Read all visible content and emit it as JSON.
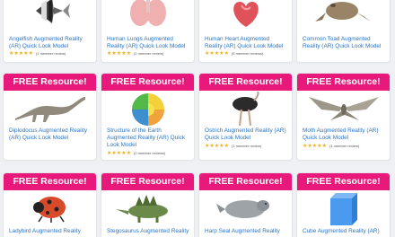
{
  "colors": {
    "banner": "#e8197a",
    "title": "#2a74c9",
    "star": "#f2b01e"
  },
  "cards": [
    {
      "title": "Angelfish Augmented Reality (AR) Quick Look Model",
      "rating_text": "(1 member review)",
      "free": false,
      "icon": "angelfish-icon"
    },
    {
      "title": "Human Lungs Augmented Reality (AR) Quick Look Model",
      "rating_text": "(1 member review)",
      "free": false,
      "icon": "lungs-icon"
    },
    {
      "title": "Human Heart Augmented Reality (AR) Quick Look Model",
      "rating_text": "(5 member reviews)",
      "free": false,
      "icon": "heart-icon"
    },
    {
      "title": "Common Toad Augmented Reality (AR) Quick Look Model",
      "rating_text": "",
      "free": false,
      "icon": "toad-icon"
    },
    {
      "title": "Diplodocus Augmented Reality (AR) Quick Look Model",
      "rating_text": "",
      "free": true,
      "banner": "FREE Resource!",
      "icon": "diplodocus-icon"
    },
    {
      "title": "Structure of the Earth Augmented Reality (AR) Quick Look Model",
      "rating_text": "(2 member reviews)",
      "free": true,
      "banner": "FREE Resource!",
      "icon": "earth-structure-icon"
    },
    {
      "title": "Ostrich Augmented Reality (AR) Quick Look Model",
      "rating_text": "(1 member review)",
      "free": true,
      "banner": "FREE Resource!",
      "icon": "ostrich-icon"
    },
    {
      "title": "Moth Augmented Reality (AR) Quick Look Model",
      "rating_text": "(1 member review)",
      "free": true,
      "banner": "FREE Resource!",
      "icon": "moth-icon"
    },
    {
      "title": "Ladybird Augmented Reality",
      "rating_text": "",
      "free": true,
      "banner": "FREE Resource!",
      "icon": "ladybird-icon"
    },
    {
      "title": "Stegosaurus Augmented Reality",
      "rating_text": "",
      "free": true,
      "banner": "FREE Resource!",
      "icon": "stegosaurus-icon"
    },
    {
      "title": "Harp Seal Augmented Reality",
      "rating_text": "",
      "free": true,
      "banner": "FREE Resource!",
      "icon": "harp-seal-icon"
    },
    {
      "title": "Cube Augmented Reality (AR)",
      "rating_text": "",
      "free": true,
      "banner": "FREE Resource!",
      "icon": "cube-icon"
    }
  ]
}
